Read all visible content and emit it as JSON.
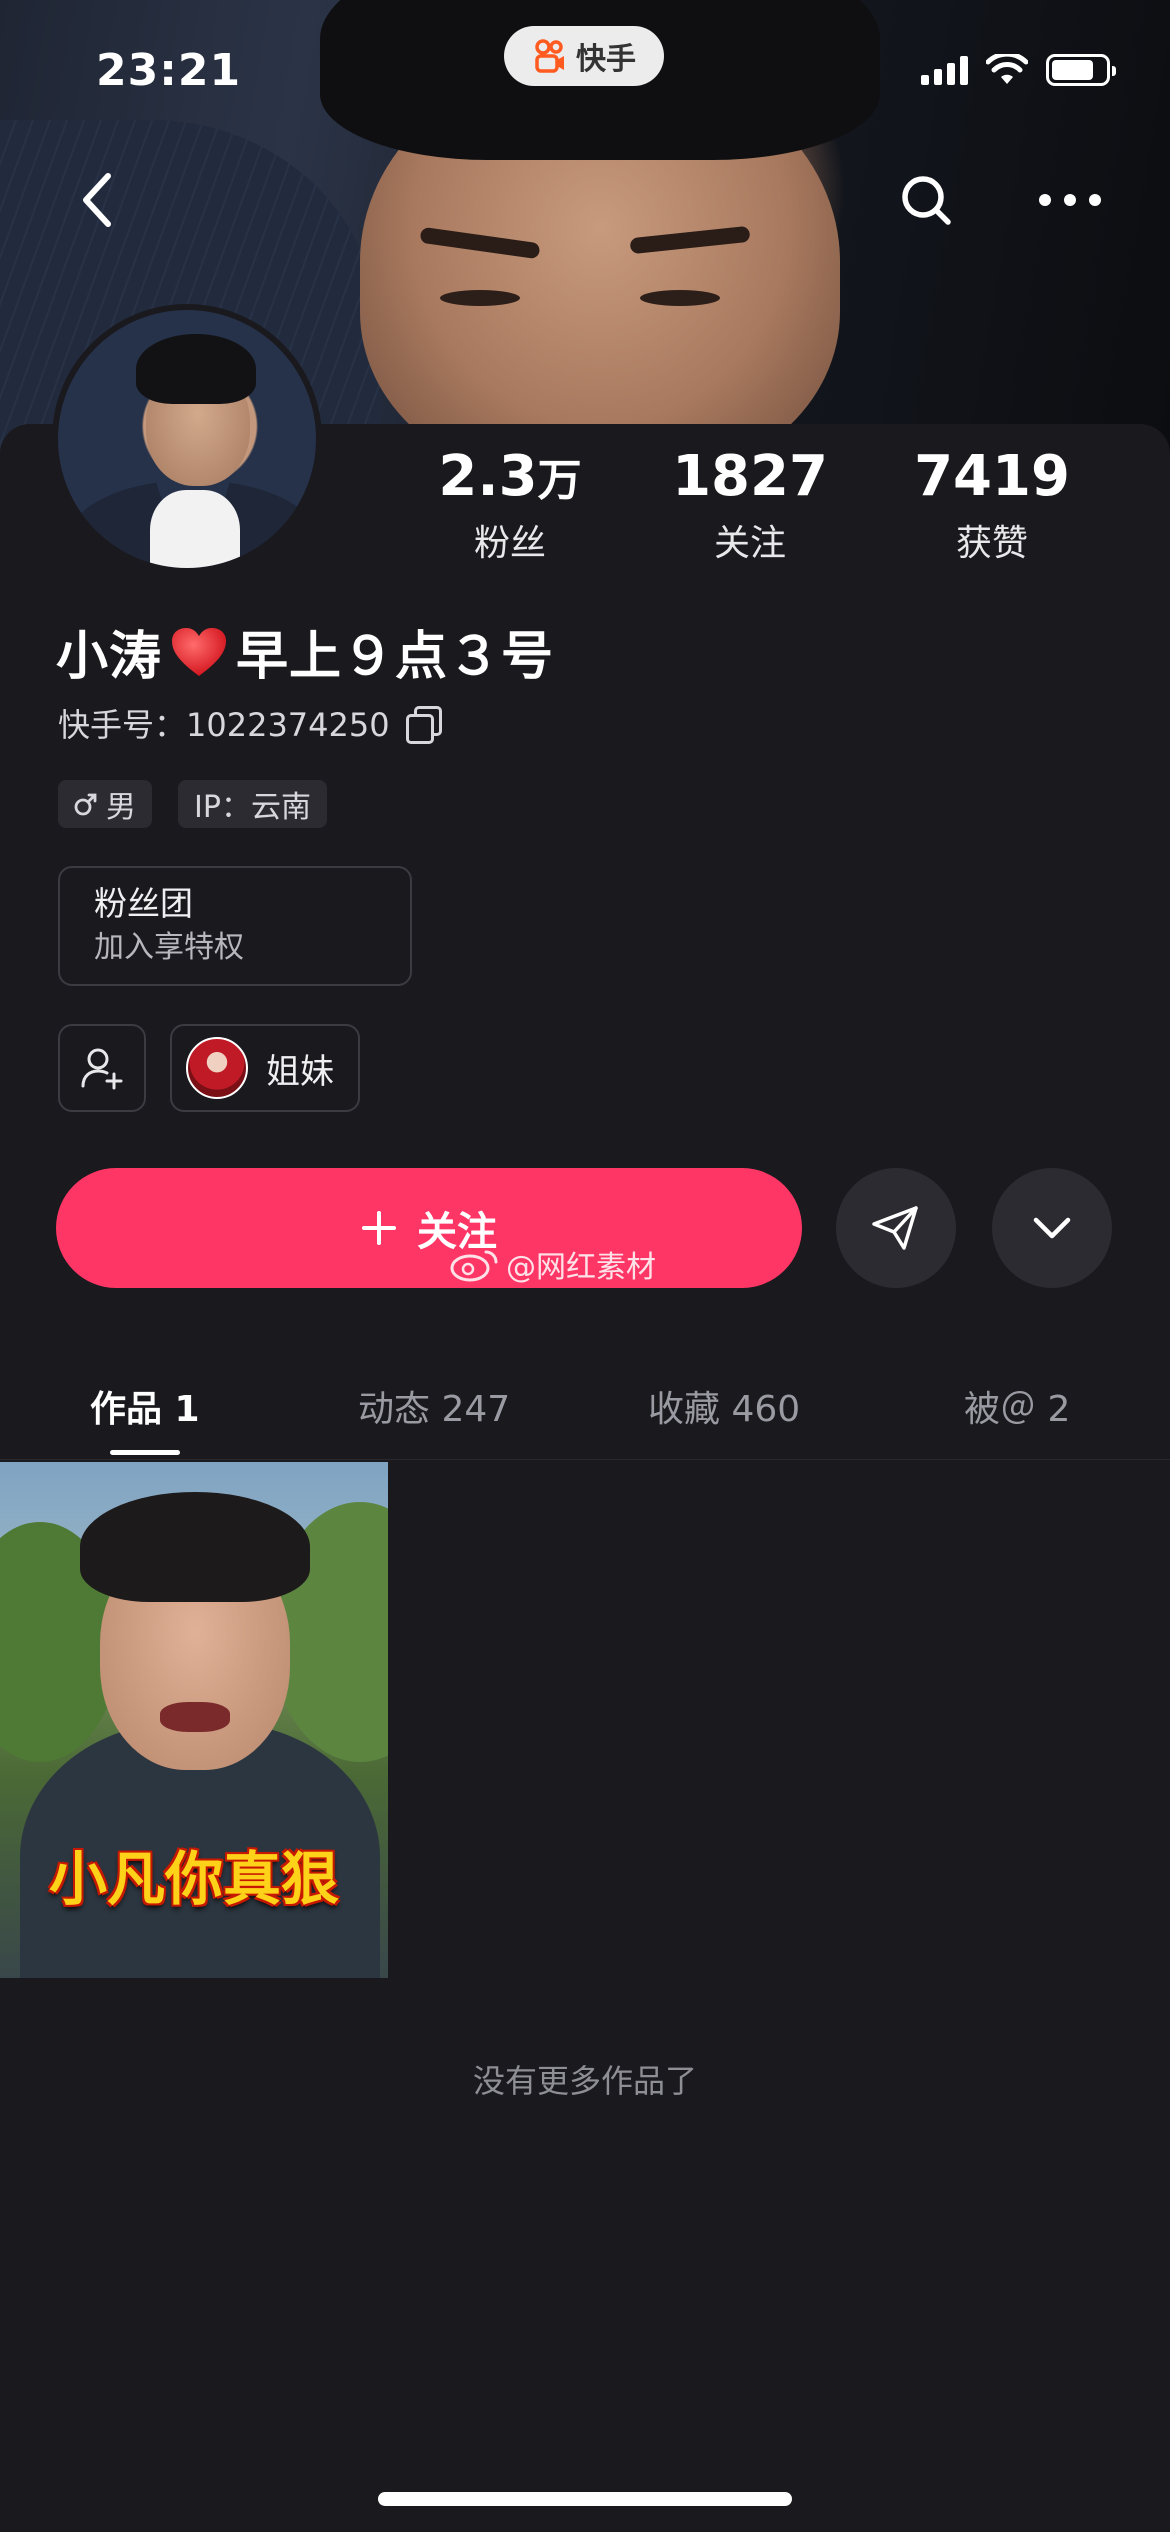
{
  "status_bar": {
    "time": "23:21",
    "app_name": "快手"
  },
  "profile": {
    "stats": [
      {
        "value": "2.3",
        "unit": "万",
        "label": "粉丝"
      },
      {
        "value": "1827",
        "unit": "",
        "label": "关注"
      },
      {
        "value": "7419",
        "unit": "",
        "label": "获赞"
      }
    ],
    "name_part1": "小涛",
    "name_part2": "早上９点３号",
    "id_label": "快手号：1022374250",
    "tags": [
      {
        "icon": "male-symbol",
        "text": "男"
      },
      {
        "icon": "",
        "text": "IP：云南"
      }
    ],
    "fan_group": {
      "title": "粉丝团",
      "subtitle": "加入享特权"
    },
    "relation_chip": "姐妹"
  },
  "actions": {
    "follow_label": "关注",
    "watermark": "@网红素材"
  },
  "tabs": [
    {
      "label": "作品 1",
      "active": true
    },
    {
      "label": "动态 247",
      "active": false
    },
    {
      "label": "收藏 460",
      "active": false
    },
    {
      "label": "被＠ 2",
      "active": false
    }
  ],
  "works": [
    {
      "caption": "小凡你真狠"
    }
  ],
  "footer": {
    "no_more": "没有更多作品了"
  },
  "colors": {
    "accent": "#fe3666",
    "background": "#1a191e"
  }
}
